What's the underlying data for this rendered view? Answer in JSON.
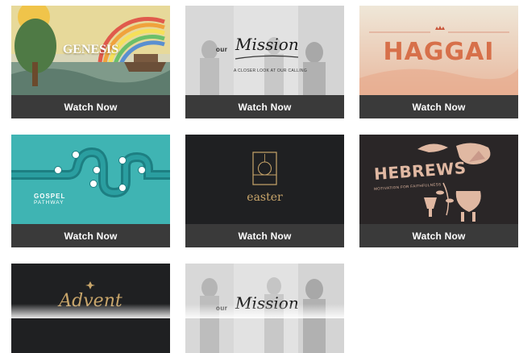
{
  "cards": [
    {
      "title": "GENESIS",
      "cta": "Watch Now"
    },
    {
      "title_prefix": "our",
      "title": "Mission",
      "subtitle": "A CLOSER LOOK AT OUR CALLING",
      "cta": "Watch Now"
    },
    {
      "title": "HAGGAI",
      "cta": "Watch Now"
    },
    {
      "title": "GOSPEL",
      "subtitle": "PATHWAY",
      "cta": "Watch Now"
    },
    {
      "title": "easter",
      "cta": "Watch Now"
    },
    {
      "title": "HEBREWS",
      "subtitle": "MOTIVATION FOR FAITHFULNESS",
      "cta": "Watch Now"
    },
    {
      "title": "Advent"
    },
    {
      "title_prefix": "our",
      "title": "Mission"
    }
  ],
  "colors": {
    "cta_bg": "#3a3a3a",
    "gospel_teal": "#3fb4b3",
    "haggai_orange": "#d7704a",
    "dark_card": "#1f2022",
    "easter_gold": "#c8a56a"
  }
}
